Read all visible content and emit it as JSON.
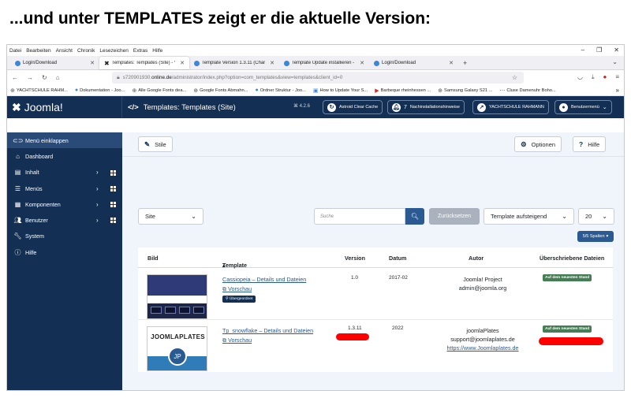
{
  "slide": {
    "heading": "...und unter TEMPLATES zeigt er die aktuelle Version:"
  },
  "browser": {
    "menu": [
      "Datei",
      "Bearbeiten",
      "Ansicht",
      "Chronik",
      "Lesezeichen",
      "Extras",
      "Hilfe"
    ],
    "tabs": [
      {
        "label": "Login/Download"
      },
      {
        "label": "Templates: Templates (Site) - Vo"
      },
      {
        "label": "Template Version 1.3.11 (Chang"
      },
      {
        "label": "Template Update installieren - Y"
      },
      {
        "label": "Login/Download"
      }
    ],
    "url_prefix": "s720901930.",
    "url_domain": "online.de",
    "url_rest": "/administrator/index.php?option=com_templates&view=templates&client_id=0",
    "bookmarks": [
      "YACHTSCHULE RAHM...",
      "Dokumentation - Joo...",
      "Alle Google Fonts dea...",
      "Google Fonts Abmahn...",
      "Ordner Struktur - Joo...",
      "How to Update Your S...",
      "Barbeque rheinhessen ...",
      "Samsung Galaxy S21 ...",
      "Cluse Damenuhr Boho..."
    ]
  },
  "joomla": {
    "logo_text": "Joomla!",
    "page_title": "Templates: Templates (Site)",
    "version": "4.2.6",
    "header_buttons": {
      "cache": "Astroid Clear Cache",
      "notif_count": "7",
      "notif_label": "Nachinstallationshinweise",
      "site_name": "YACHTSCHULE RAHMANN",
      "user_menu": "Benutzermenü"
    },
    "sidebar": [
      {
        "label": "Menü einklappen"
      },
      {
        "label": "Dashboard"
      },
      {
        "label": "Inhalt"
      },
      {
        "label": "Menüs"
      },
      {
        "label": "Komponenten"
      },
      {
        "label": "Benutzer"
      },
      {
        "label": "System"
      },
      {
        "label": "Hilfe"
      }
    ],
    "toolbar": {
      "styles": "Stile",
      "options": "Optionen",
      "help": "Hilfe"
    },
    "filters": {
      "client": "Site",
      "search_placeholder": "Suche",
      "reset": "Zurücksetzen",
      "sort": "Template aufsteigend",
      "limit": "20",
      "columns": "5/5 Spalten"
    },
    "table": {
      "headers": {
        "image": "Bild",
        "template": "Template",
        "version": "Version",
        "date": "Datum",
        "author": "Autor",
        "overrides": "Überschriebene Dateien"
      },
      "rows": [
        {
          "name": "Cassiopeia – Details und Dateien",
          "preview": "Vorschau",
          "parent_badge": "Übergeordnet",
          "version": "1.0",
          "date": "2017-02",
          "author": "Joomla! Project",
          "email": "admin@joomla.org",
          "status": "Auf dem neuesten Stand"
        },
        {
          "name": "Tp_snowflake – Details und Dateien",
          "preview": "Vorschau",
          "thumb_brand": "JOOMLAPLATES",
          "thumb_initials": "JP",
          "version": "1.3.11",
          "date": "2022",
          "author": "joomlaPlates",
          "email": "support@joomlaplates.de",
          "url": "https://www.Joomlaplates.de",
          "status": "Auf dem neuesten Stand"
        }
      ]
    }
  },
  "colors": {
    "header": "#132f53",
    "status_green": "#457d54",
    "highlight_red": "#ff0000"
  }
}
